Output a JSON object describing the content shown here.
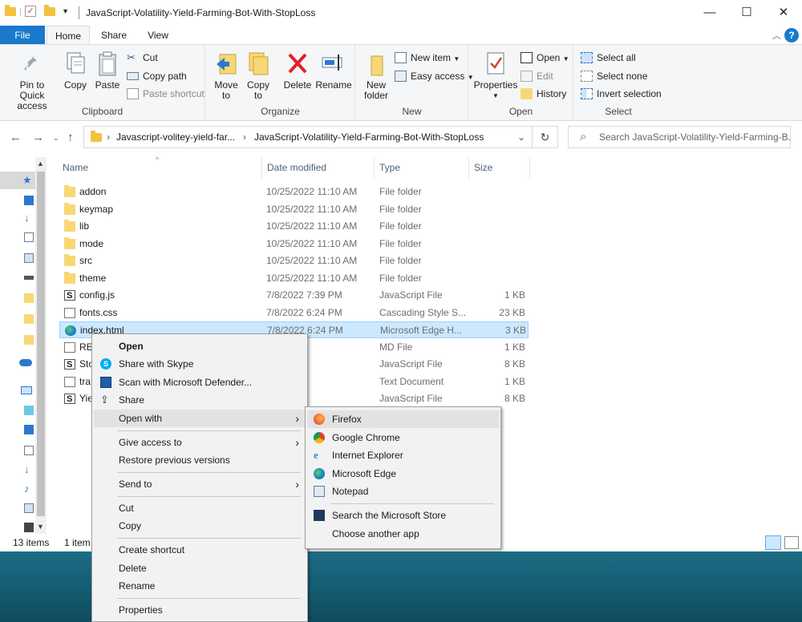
{
  "window": {
    "title": "JavaScript-Volatility-Yield-Farming-Bot-With-StopLoss",
    "controls": {
      "minimize": "—",
      "maximize": "☐",
      "close": "✕"
    }
  },
  "tabs": {
    "file": "File",
    "home": "Home",
    "share": "Share",
    "view": "View"
  },
  "ribbon": {
    "clipboard": {
      "label": "Clipboard",
      "pin": "Pin to Quick access",
      "copy": "Copy",
      "paste": "Paste",
      "cut": "Cut",
      "copy_path": "Copy path",
      "paste_shortcut": "Paste shortcut"
    },
    "organize": {
      "label": "Organize",
      "move_to": "Move to",
      "copy_to": "Copy to",
      "delete": "Delete",
      "rename": "Rename"
    },
    "new": {
      "label": "New",
      "new_folder": "New folder",
      "new_item": "New item",
      "easy_access": "Easy access"
    },
    "open": {
      "label": "Open",
      "properties": "Properties",
      "open": "Open",
      "edit": "Edit",
      "history": "History"
    },
    "select": {
      "label": "Select",
      "select_all": "Select all",
      "select_none": "Select none",
      "invert": "Invert selection"
    }
  },
  "address": {
    "crumb1": "Javascript-volitey-yield-far...",
    "crumb2": "JavaScript-Volatility-Yield-Farming-Bot-With-StopLoss",
    "search_placeholder": "Search JavaScript-Volatility-Yield-Farming-B..."
  },
  "columns": {
    "name": "Name",
    "date": "Date modified",
    "type": "Type",
    "size": "Size"
  },
  "files": [
    {
      "name": "addon",
      "date": "10/25/2022 11:10 AM",
      "type": "File folder",
      "size": "",
      "icon": "folder"
    },
    {
      "name": "keymap",
      "date": "10/25/2022 11:10 AM",
      "type": "File folder",
      "size": "",
      "icon": "folder"
    },
    {
      "name": "lib",
      "date": "10/25/2022 11:10 AM",
      "type": "File folder",
      "size": "",
      "icon": "folder"
    },
    {
      "name": "mode",
      "date": "10/25/2022 11:10 AM",
      "type": "File folder",
      "size": "",
      "icon": "folder"
    },
    {
      "name": "src",
      "date": "10/25/2022 11:10 AM",
      "type": "File folder",
      "size": "",
      "icon": "folder"
    },
    {
      "name": "theme",
      "date": "10/25/2022 11:10 AM",
      "type": "File folder",
      "size": "",
      "icon": "folder"
    },
    {
      "name": "config.js",
      "date": "7/8/2022 7:39 PM",
      "type": "JavaScript File",
      "size": "1 KB",
      "icon": "js"
    },
    {
      "name": "fonts.css",
      "date": "7/8/2022 6:24 PM",
      "type": "Cascading Style S...",
      "size": "23 KB",
      "icon": "doc"
    },
    {
      "name": "index.html",
      "date": "7/8/2022 6:24 PM",
      "type": "Microsoft Edge H...",
      "size": "3 KB",
      "icon": "edge"
    },
    {
      "name": "RE",
      "date": ":22 PM",
      "type": "MD File",
      "size": "1 KB",
      "icon": "doc"
    },
    {
      "name": "Sto",
      "date": ":24 PM",
      "type": "JavaScript File",
      "size": "8 KB",
      "icon": "js"
    },
    {
      "name": "tra",
      "date": ":24 PM",
      "type": "Text Document",
      "size": "1 KB",
      "icon": "doc"
    },
    {
      "name": "Yie",
      "date": ":24 PM",
      "type": "JavaScript File",
      "size": "8 KB",
      "icon": "js"
    }
  ],
  "status": {
    "items": "13 items",
    "selected": "1 item"
  },
  "context_menu": {
    "open": "Open",
    "share_skype": "Share with Skype",
    "scan": "Scan with Microsoft Defender...",
    "share": "Share",
    "open_with": "Open with",
    "give_access": "Give access to",
    "restore": "Restore previous versions",
    "send_to": "Send to",
    "cut": "Cut",
    "copy": "Copy",
    "create_shortcut": "Create shortcut",
    "delete": "Delete",
    "rename": "Rename",
    "properties": "Properties"
  },
  "submenu": {
    "firefox": "Firefox",
    "chrome": "Google Chrome",
    "ie": "Internet Explorer",
    "edge": "Microsoft Edge",
    "notepad": "Notepad",
    "store": "Search the Microsoft Store",
    "another": "Choose another app"
  }
}
